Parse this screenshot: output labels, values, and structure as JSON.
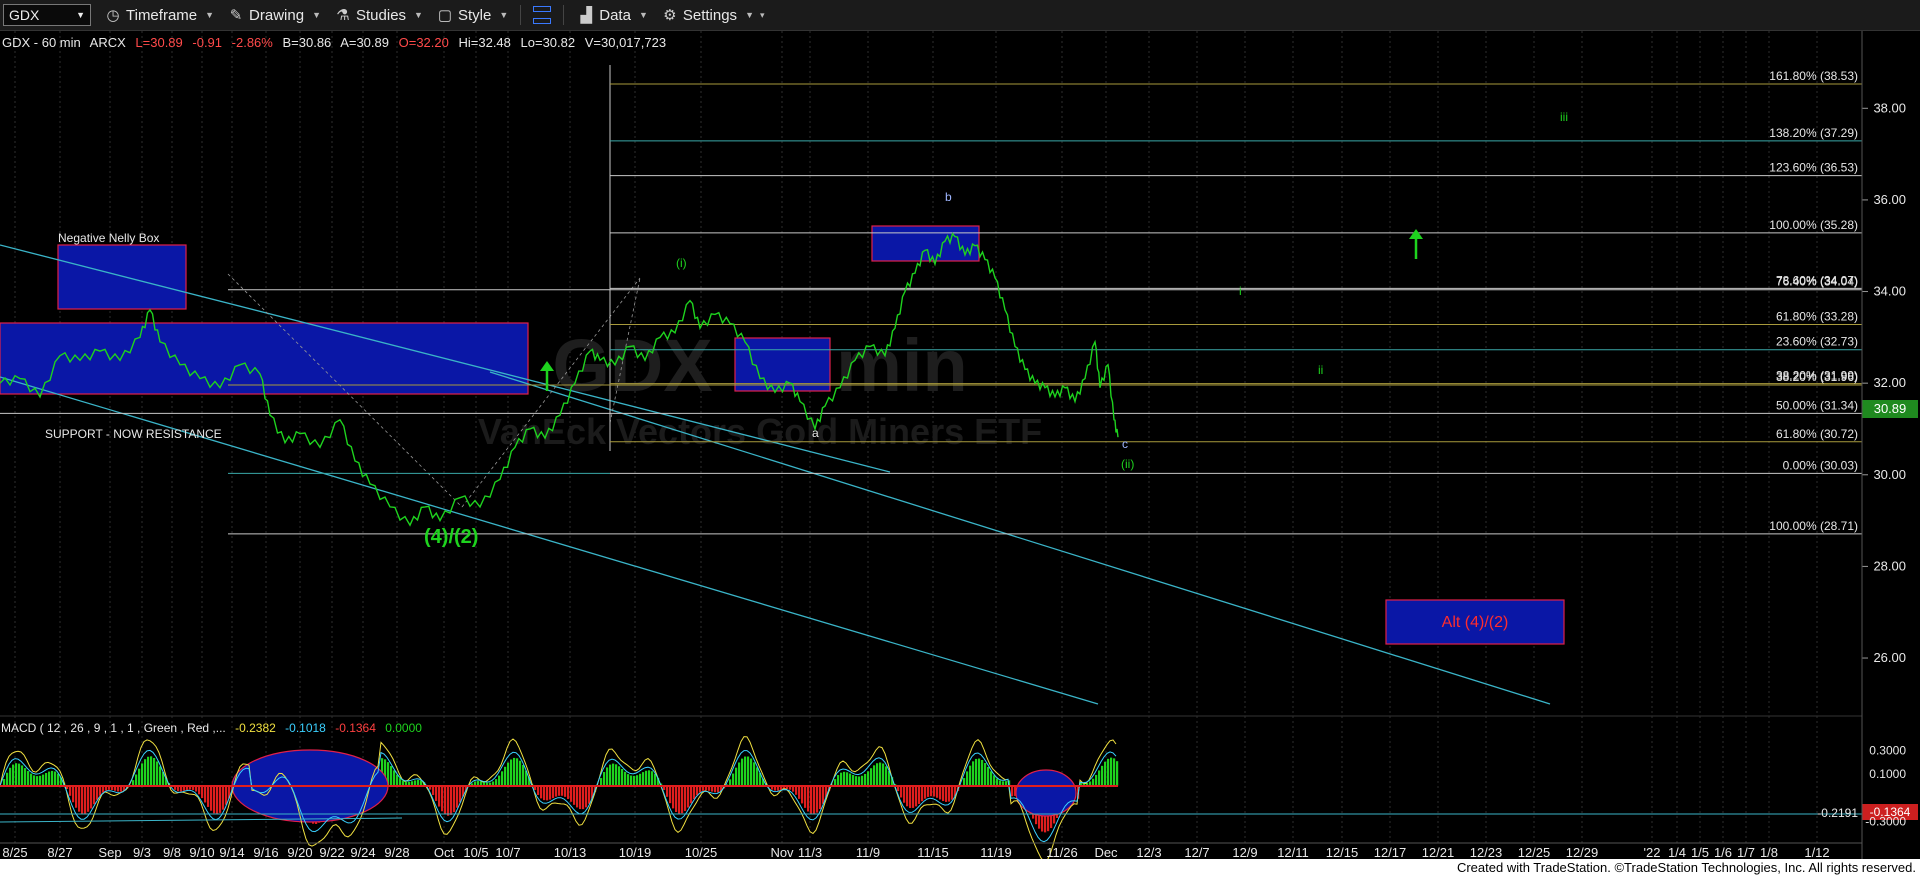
{
  "toolbar": {
    "symbol": "GDX",
    "timeframe_label": "Timeframe",
    "drawing_label": "Drawing",
    "studies_label": "Studies",
    "style_label": "Style",
    "data_label": "Data",
    "settings_label": "Settings"
  },
  "header": {
    "title": "GDX - 60 min",
    "exchange": "ARCX",
    "last": "L=30.89",
    "change": "-0.91",
    "change_pct": "-2.86%",
    "bid": "B=30.86",
    "ask": "A=30.89",
    "open": "O=32.20",
    "high": "Hi=32.48",
    "low": "Lo=30.82",
    "volume": "V=30,017,723"
  },
  "watermark": {
    "symbol": "GDX 60 min",
    "name": "VanEck Vectors Gold Miners ETF"
  },
  "price_axis": {
    "ticks": [
      {
        "label": "38.00",
        "value": 38
      },
      {
        "label": "36.00",
        "value": 36
      },
      {
        "label": "34.00",
        "value": 34
      },
      {
        "label": "32.00",
        "value": 32
      },
      {
        "label": "30.00",
        "value": 30
      },
      {
        "label": "28.00",
        "value": 28
      },
      {
        "label": "26.00",
        "value": 26
      }
    ],
    "last_price_label": "30.89",
    "last_price_color": "#1f8a1f"
  },
  "macd_axis": {
    "ticks": [
      {
        "label": "0.3000",
        "value": 0.3
      },
      {
        "label": "0.1000",
        "value": 0.1
      },
      {
        "label": "-0.3000",
        "value": -0.3
      }
    ],
    "level_label": "-0.2191",
    "badge_label": "-0.1364"
  },
  "date_axis": [
    {
      "label": "8/25",
      "bar": 15
    },
    {
      "label": "8/27",
      "bar": 60
    },
    {
      "label": "Sep",
      "bar": 110
    },
    {
      "label": "9/3",
      "bar": 142
    },
    {
      "label": "9/8",
      "bar": 172
    },
    {
      "label": "9/10",
      "bar": 202
    },
    {
      "label": "9/14",
      "bar": 232
    },
    {
      "label": "9/16",
      "bar": 266
    },
    {
      "label": "9/20",
      "bar": 300
    },
    {
      "label": "9/22",
      "bar": 332
    },
    {
      "label": "9/24",
      "bar": 363
    },
    {
      "label": "9/28",
      "bar": 397
    },
    {
      "label": "Oct",
      "bar": 444
    },
    {
      "label": "10/5",
      "bar": 476
    },
    {
      "label": "10/7",
      "bar": 508
    },
    {
      "label": "10/13",
      "bar": 570
    },
    {
      "label": "10/19",
      "bar": 635
    },
    {
      "label": "10/25",
      "bar": 701
    },
    {
      "label": "Nov",
      "bar": 782
    },
    {
      "label": "11/3",
      "bar": 810
    },
    {
      "label": "11/9",
      "bar": 868
    },
    {
      "label": "11/15",
      "bar": 933
    },
    {
      "label": "11/19",
      "bar": 996
    },
    {
      "label": "11/26",
      "bar": 1062
    },
    {
      "label": "Dec",
      "bar": 1106
    },
    {
      "label": "12/3",
      "bar": 1149
    },
    {
      "label": "12/7",
      "bar": 1197
    },
    {
      "label": "12/9",
      "bar": 1245
    },
    {
      "label": "12/11",
      "bar": 1293
    },
    {
      "label": "12/15",
      "bar": 1342
    },
    {
      "label": "12/17",
      "bar": 1390
    },
    {
      "label": "12/21",
      "bar": 1438
    },
    {
      "label": "12/23",
      "bar": 1486
    },
    {
      "label": "12/25",
      "bar": 1534
    },
    {
      "label": "12/29",
      "bar": 1582
    },
    {
      "label": "'22",
      "bar": 1652
    },
    {
      "label": "1/4",
      "bar": 1677
    },
    {
      "label": "1/5",
      "bar": 1700
    },
    {
      "label": "1/6",
      "bar": 1723
    },
    {
      "label": "1/7",
      "bar": 1746
    },
    {
      "label": "1/8",
      "bar": 1769
    },
    {
      "label": "1/12",
      "bar": 1817
    }
  ],
  "fib_levels": [
    {
      "label": "161.80% (38.53)",
      "price": 38.53,
      "color": "#a89a3c"
    },
    {
      "label": "138.20% (37.29)",
      "price": 37.29,
      "color": "#3aa8a8"
    },
    {
      "label": "123.60% (36.53)",
      "price": 36.53,
      "color": "#c8c8c8"
    },
    {
      "label": "100.00% (35.28)",
      "price": 35.28,
      "color": "#c8c8c8"
    },
    {
      "label": "76.40% (34.04)",
      "price": 34.04,
      "color": "#c8c8c8"
    },
    {
      "label": "78.60% (34.07)",
      "price": 34.07,
      "color": "#c8c8c8"
    },
    {
      "label": "61.80% (33.28)",
      "price": 33.28,
      "color": "#a89a3c"
    },
    {
      "label": "23.60% (32.73)",
      "price": 32.73,
      "color": "#3aa8a8"
    },
    {
      "label": "38.20% (31.99)",
      "price": 31.99,
      "color": "#a89a3c"
    },
    {
      "label": "38.20% (31.96)",
      "price": 31.96,
      "color": "#a89a3c"
    },
    {
      "label": "50.00% (31.34)",
      "price": 31.34,
      "color": "#c8c8c8"
    },
    {
      "label": "61.80% (30.72)",
      "price": 30.72,
      "color": "#a89a3c"
    },
    {
      "label": "0.00% (30.03)",
      "price": 30.03,
      "color": "#c8c8c8"
    },
    {
      "label": "100.00% (28.71)",
      "price": 28.71,
      "color": "#c8c8c8"
    }
  ],
  "annotations": {
    "negative_nelly": "Negative Nelly Box",
    "support": "SUPPORT -  NOW RESISTANCE",
    "wave_4_2": "(4)/(2)",
    "wave_i_paren": "(i)",
    "wave_ii_paren": "(ii)",
    "wave_a": "a",
    "wave_b": "b",
    "wave_c": "c",
    "wave_i": "i",
    "wave_ii": "ii",
    "wave_iii": "iii",
    "alt_box": "Alt (4)/(2)"
  },
  "macd_legend": {
    "name": "MACD ( 12 , 26 , 9 , 1 , 1 , Green , Red ,...",
    "v1": "-0.2382",
    "v2": "-0.1018",
    "v3": "-0.1364",
    "v4": "0.0000"
  },
  "footer": {
    "credit": "Created with TradeStation. ©TradeStation Technologies, Inc. All rights reserved."
  },
  "chart_data": {
    "type": "line",
    "title": "GDX - 60 min",
    "ylim": [
      24.8,
      39.6
    ],
    "xlim": [
      0,
      1862
    ],
    "series": [
      {
        "values": [
          [
            0,
            32.0
          ],
          [
            20,
            32.1
          ],
          [
            40,
            31.7
          ],
          [
            60,
            32.6
          ],
          [
            80,
            32.5
          ],
          [
            100,
            32.7
          ],
          [
            120,
            32.5
          ],
          [
            140,
            33.0
          ],
          [
            150,
            33.6
          ],
          [
            160,
            32.9
          ],
          [
            180,
            32.4
          ],
          [
            200,
            32.1
          ],
          [
            220,
            31.9
          ],
          [
            240,
            32.4
          ],
          [
            260,
            32.2
          ],
          [
            270,
            31.3
          ],
          [
            285,
            30.7
          ],
          [
            300,
            30.9
          ],
          [
            320,
            30.6
          ],
          [
            340,
            31.2
          ],
          [
            355,
            30.3
          ],
          [
            370,
            29.8
          ],
          [
            390,
            29.3
          ],
          [
            410,
            28.9
          ],
          [
            425,
            29.3
          ],
          [
            440,
            29.0
          ],
          [
            460,
            29.5
          ],
          [
            480,
            29.3
          ],
          [
            500,
            29.9
          ],
          [
            515,
            30.6
          ],
          [
            530,
            31.0
          ],
          [
            545,
            30.8
          ],
          [
            560,
            31.3
          ],
          [
            575,
            32.0
          ],
          [
            590,
            32.7
          ],
          [
            600,
            32.5
          ],
          [
            615,
            32.4
          ],
          [
            630,
            32.8
          ],
          [
            645,
            32.5
          ],
          [
            660,
            33.0
          ],
          [
            675,
            33.1
          ],
          [
            690,
            33.8
          ],
          [
            700,
            33.2
          ],
          [
            715,
            33.5
          ],
          [
            730,
            33.3
          ],
          [
            745,
            32.9
          ],
          [
            760,
            32.1
          ],
          [
            775,
            31.8
          ],
          [
            790,
            32.0
          ],
          [
            800,
            31.6
          ],
          [
            815,
            31.0
          ],
          [
            825,
            31.5
          ],
          [
            840,
            31.9
          ],
          [
            855,
            32.5
          ],
          [
            870,
            32.8
          ],
          [
            885,
            32.6
          ],
          [
            895,
            33.2
          ],
          [
            905,
            34.0
          ],
          [
            915,
            34.4
          ],
          [
            925,
            34.9
          ],
          [
            935,
            34.6
          ],
          [
            945,
            35.1
          ],
          [
            955,
            35.2
          ],
          [
            965,
            34.8
          ],
          [
            975,
            35.0
          ],
          [
            985,
            34.7
          ],
          [
            995,
            34.3
          ],
          [
            1005,
            33.6
          ],
          [
            1015,
            32.8
          ],
          [
            1025,
            32.3
          ],
          [
            1035,
            32.0
          ],
          [
            1045,
            31.9
          ],
          [
            1055,
            31.7
          ],
          [
            1065,
            31.9
          ],
          [
            1075,
            31.6
          ],
          [
            1085,
            32.1
          ],
          [
            1095,
            32.9
          ],
          [
            1100,
            31.9
          ],
          [
            1108,
            32.4
          ],
          [
            1114,
            31.2
          ],
          [
            1118,
            30.82
          ]
        ]
      }
    ]
  }
}
